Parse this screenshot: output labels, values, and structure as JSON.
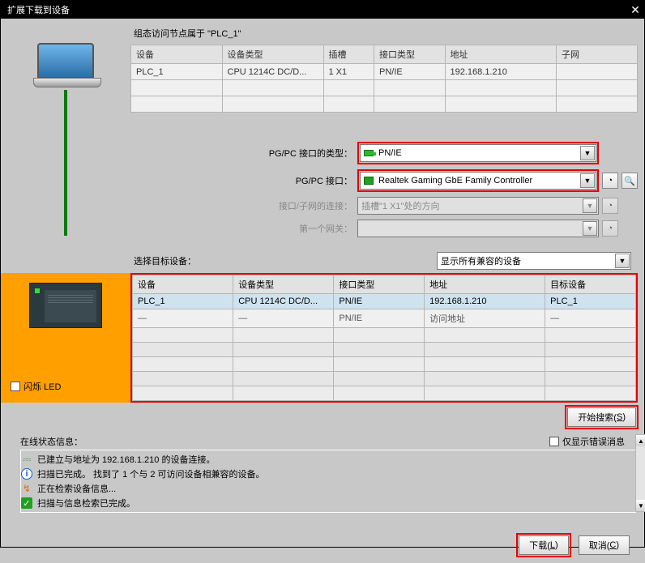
{
  "title": "扩展下载到设备",
  "config_label": "组态访问节点属于 \"PLC_1\"",
  "cfg_headers": {
    "device": "设备",
    "type": "设备类型",
    "slot": "插槽",
    "iface": "接口类型",
    "addr": "地址",
    "subnet": "子网"
  },
  "cfg_row": {
    "device": "PLC_1",
    "type": "CPU 1214C DC/D...",
    "slot": "1 X1",
    "iface": "PN/IE",
    "addr": "192.168.1.210",
    "subnet": ""
  },
  "form": {
    "iface_type_label": "PG/PC 接口的类型：",
    "iface_type_value": "PN/IE",
    "iface_label": "PG/PC 接口：",
    "iface_value": "Realtek Gaming GbE Family Controller",
    "conn_label": "接口/子网的连接：",
    "conn_value": "插槽\"1 X1\"处的方向",
    "gw_label": "第一个网关：",
    "gw_value": ""
  },
  "target_label": "选择目标设备：",
  "target_filter": "显示所有兼容的设备",
  "tgt_headers": {
    "device": "设备",
    "type": "设备类型",
    "iface": "接口类型",
    "addr": "地址",
    "target": "目标设备"
  },
  "tgt_rows": [
    {
      "device": "PLC_1",
      "type": "CPU 1214C DC/D...",
      "iface": "PN/IE",
      "addr": "192.168.1.210",
      "target": "PLC_1"
    },
    {
      "device": "—",
      "type": "—",
      "iface": "PN/IE",
      "addr": "访问地址",
      "target": "—"
    }
  ],
  "blink_led": "闪烁 LED",
  "btn_search": "开始搜索(",
  "btn_search_u": "S",
  "btn_search_end": ")",
  "status_label": "在线状态信息：",
  "err_only": "仅显示错误消息",
  "status": [
    "已建立与地址为 192.168.1.210 的设备连接。",
    "扫描已完成。 找到了 1 个与 2 可访问设备相兼容的设备。",
    "正在检索设备信息...",
    "扫描与信息检索已完成。"
  ],
  "btn_load": "下载(",
  "btn_load_u": "L",
  "btn_load_end": ")",
  "btn_cancel": "取消(",
  "btn_cancel_u": "C",
  "btn_cancel_end": ")"
}
